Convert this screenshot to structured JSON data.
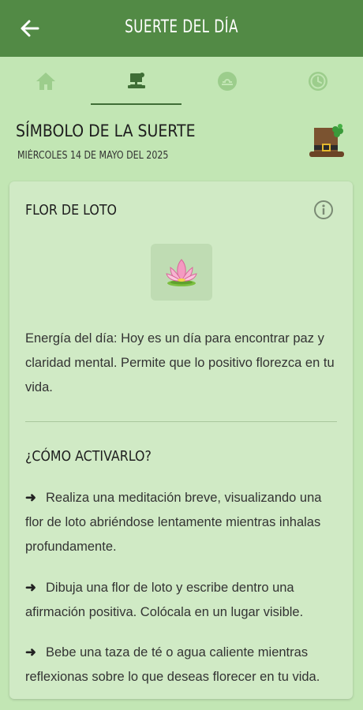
{
  "appbar": {
    "title": "SUERTE DEL DÍA",
    "back_icon": "arrow-left-icon"
  },
  "tabs": [
    {
      "icon": "home-icon",
      "active": false
    },
    {
      "icon": "leprechaun-hat-icon",
      "active": true
    },
    {
      "icon": "libra-zodiac-icon",
      "active": false
    },
    {
      "icon": "clock-icon",
      "active": false
    }
  ],
  "header": {
    "title": "SÍMBOLO DE LA SUERTE",
    "date": "MIÉRCOLES 14 DE MAYO DEL 2025",
    "hat_icon": "leprechaun-hat-clover-icon"
  },
  "card": {
    "symbol_name": "FLOR DE LOTO",
    "info_icon": "info-icon",
    "symbol_icon": "lotus-flower-icon",
    "energy": "Energía del día: Hoy es un día para encontrar paz y claridad mental. Permite que lo positivo florezca en tu vida.",
    "howto_title": "¿CÓMO ACTIVARLO?",
    "steps": [
      {
        "arrow": "➜",
        "text": "Realiza una meditación breve, visualizando una flor de loto abriéndose lentamente mientras inhalas profundamente."
      },
      {
        "arrow": "➜",
        "text": "Dibuja una flor de loto y escribe dentro una afirmación positiva. Colócala en un lugar visible."
      },
      {
        "arrow": "➜",
        "text": "Bebe una taza de té o agua caliente mientras reflexionas sobre lo que deseas florecer en tu vida."
      }
    ]
  },
  "colors": {
    "appbar": "#528a45",
    "background": "#c2e6b4",
    "card": "#d0eac5",
    "tab_icon_inactive": "#9ccd8c",
    "tab_icon_active": "#3f6e36"
  }
}
